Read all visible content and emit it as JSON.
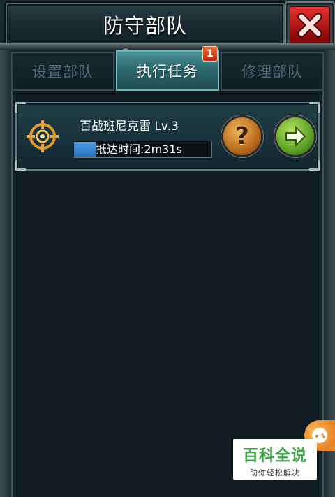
{
  "window": {
    "title": "防守部队"
  },
  "tabs": [
    {
      "label": "设置部队",
      "active": false
    },
    {
      "label": "执行任务",
      "active": true,
      "badge": "1"
    },
    {
      "label": "修理部队",
      "active": false
    }
  ],
  "troops": [
    {
      "name": "百战班尼克雷 Lv.3",
      "status_text": "抵达时间:2m31s",
      "progress_fraction": 0.16,
      "icon": "target-crosshair-icon"
    }
  ],
  "watermark": {
    "title": "百科全说",
    "subtitle": "助你轻松解决"
  },
  "colors": {
    "close_red": "#c41e1c",
    "tab_active": "#2c6a70",
    "progress_blue": "#3a86d6",
    "help_orange": "#d98a2c",
    "go_green": "#6bb22f"
  }
}
